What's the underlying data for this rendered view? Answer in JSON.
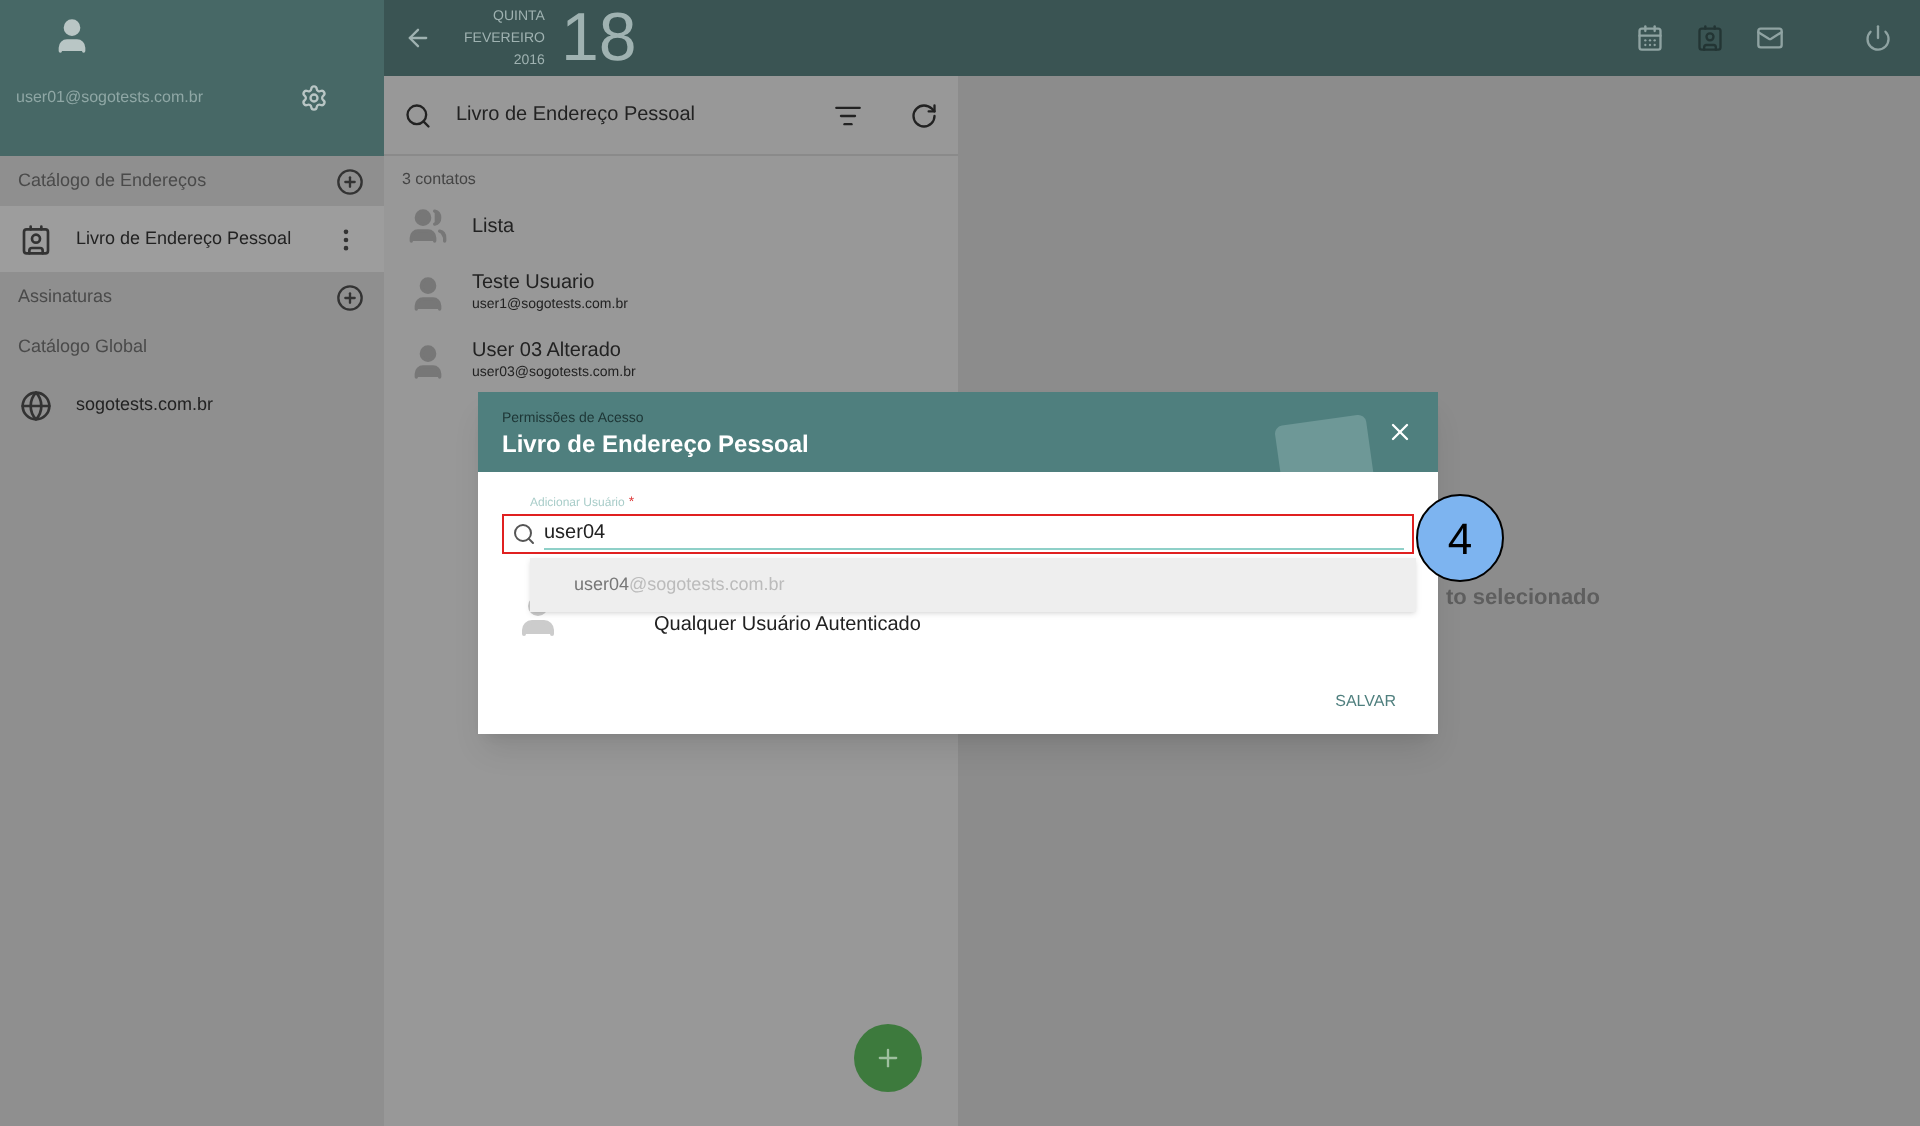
{
  "account": {
    "email": "user01@sogotests.com.br"
  },
  "date": {
    "weekday": "QUINTA",
    "month": "FEVEREIRO",
    "year": "2016",
    "day": "18"
  },
  "sidebar": {
    "sections": [
      {
        "title": "Catálogo de Endereços",
        "addable": true,
        "items": [
          {
            "label": "Livro de Endereço Pessoal",
            "kind": "addressbook",
            "selected": true
          }
        ]
      },
      {
        "title": "Assinaturas",
        "addable": true
      },
      {
        "title": "Catálogo Global",
        "addable": false,
        "items": [
          {
            "label": "sogotests.com.br",
            "kind": "globe",
            "selected": false
          }
        ]
      }
    ]
  },
  "list": {
    "title": "Livro de Endereço Pessoal",
    "count": "3 contatos",
    "contacts": [
      {
        "kind": "group",
        "name": "Lista"
      },
      {
        "kind": "person",
        "name": "Teste Usuario",
        "email": "user1@sogotests.com.br"
      },
      {
        "kind": "person",
        "name": "User 03 Alterado",
        "email": "user03@sogotests.com.br"
      }
    ]
  },
  "detail": {
    "empty_text": "to selecionado"
  },
  "dialog": {
    "subtitle": "Permissões de Acesso",
    "title": "Livro de Endereço Pessoal",
    "field": {
      "label": "Adicionar Usuário",
      "required": true,
      "required_mark": "*",
      "value": "user04"
    },
    "suggestion": {
      "match": "user04",
      "rest": "@sogotests.com.br"
    },
    "users": [
      {
        "name": "Qualquer Usuário Autenticado"
      }
    ],
    "buttons": [
      "SALVAR"
    ]
  },
  "callout": {
    "number": "4"
  }
}
